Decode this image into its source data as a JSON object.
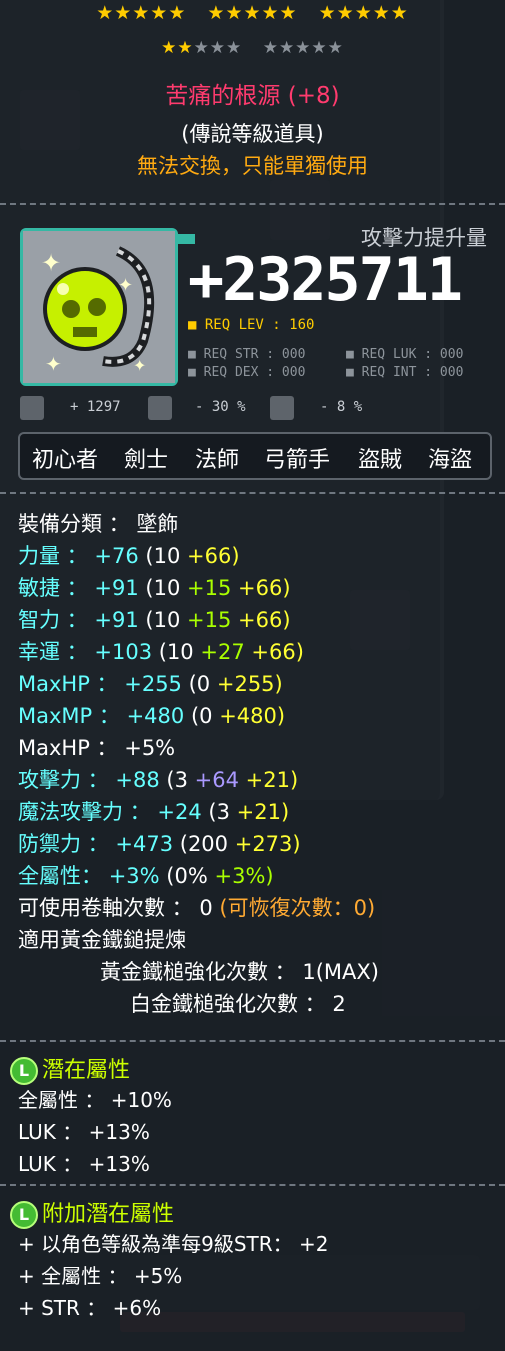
{
  "item": {
    "top_star_groups": [
      "★★★★★",
      "★★★★★",
      "★★★★★"
    ],
    "sub_stars_on": "★★",
    "sub_stars_off_a": "★★★",
    "sub_stars_off_b": "★★★★★",
    "name": "苦痛的根源 (+8)",
    "grade": "(傳說等級道具)",
    "trade_note": "無法交換，只能單獨使用",
    "attack_increase_caption": "攻擊力提升量",
    "attack_increase_value": "+2325711",
    "req_lev": "■ REQ LEV : 160",
    "req_str": "■ REQ STR : 000",
    "req_dex": "■ REQ DEX : 000",
    "req_luk": "■ REQ LUK : 000",
    "req_int": "■ REQ INT : 000",
    "mini_stat_1": "+ 1297",
    "mini_stat_2": "- 30 %",
    "mini_stat_3": "- 8 %",
    "jobs": [
      "初心者",
      "劍士",
      "法師",
      "弓箭手",
      "盜賊",
      "海盜"
    ]
  },
  "stats": {
    "category": "裝備分類 ： 墜飾",
    "str_label": "力量 ：",
    "str_total": "+76",
    "str_base": "(10",
    "str_star": "+66)",
    "dex_label": "敏捷 ：",
    "dex_total": "+91",
    "dex_base": "(10",
    "dex_flame": "+15",
    "dex_star": "+66)",
    "int_label": "智力 ：",
    "int_total": "+91",
    "int_base": "(10",
    "int_flame": "+15",
    "int_star": "+66)",
    "luk_label": "幸運 ：",
    "luk_total": "+103",
    "luk_base": "(10",
    "luk_flame": "+27",
    "luk_star": "+66)",
    "maxhp_label": "MaxHP ：",
    "maxhp_total": "+255",
    "maxhp_base": "(0",
    "maxhp_star": "+255)",
    "maxmp_label": "MaxMP ：",
    "maxmp_total": "+480",
    "maxmp_base": "(0",
    "maxmp_star": "+480)",
    "maxhp_pct": "MaxHP ： +5%",
    "atk_label": "攻擊力 ：",
    "atk_total": "+88",
    "atk_base": "(3",
    "atk_flame": "+64",
    "atk_star": "+21)",
    "matk_label": "魔法攻擊力 ：",
    "matk_total": "+24",
    "matk_base": "(3",
    "matk_star": "+21)",
    "def_label": "防禦力 ：",
    "def_total": "+473",
    "def_base": "(200",
    "def_star": "+273)",
    "allstat_label": "全屬性：",
    "allstat_total": "+3%",
    "allstat_base": "(0%",
    "allstat_flame": "+3%)",
    "scroll_slots": "可使用卷軸次數 ： 0",
    "scroll_recover": "(可恢復次數：0)",
    "golden_hammer": "適用黃金鐵鎚提煉",
    "golden_hammer_count": "黃金鐵槌強化次數 ： 1(MAX)",
    "platinum_hammer_count": "白金鐵槌強化次數 ： 2"
  },
  "potential": {
    "badge": "L",
    "title": "潛在屬性",
    "lines": [
      "全屬性 ： +10%",
      "LUK ： +13%",
      "LUK ： +13%"
    ]
  },
  "additional_potential": {
    "badge": "L",
    "title": "附加潛在屬性",
    "lines": [
      "+ 以角色等級為準每9級STR： +2",
      "+ 全屬性 ： +5%",
      "+ STR ： +6%"
    ]
  }
}
